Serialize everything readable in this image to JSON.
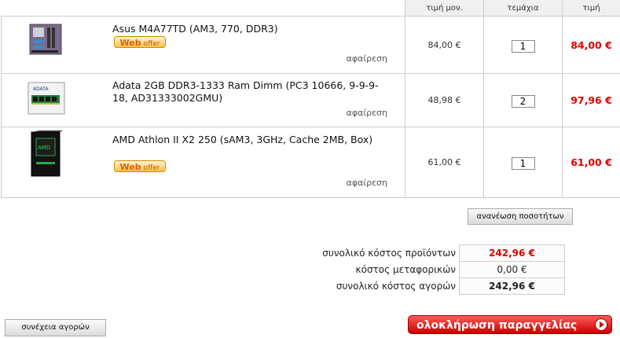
{
  "header": {
    "unit_price": "τιμή μον.",
    "quantity": "τεμάχια",
    "price": "τιμή"
  },
  "items": [
    {
      "name": "Asus M4A77TD (AM3, 770, DDR3)",
      "web_offer": true,
      "web_offer_label": {
        "web": "Web",
        "offer": "offer"
      },
      "remove_label": "αφαίρεση",
      "unit_price": "84,00 €",
      "quantity": "1",
      "price": "84,00 €",
      "icon": "motherboard-icon"
    },
    {
      "name": "Adata 2GB DDR3-1333 Ram Dimm (PC3 10666, 9-9-9-18, AD31333002GMU)",
      "web_offer": false,
      "remove_label": "αφαίρεση",
      "unit_price": "48,98 €",
      "quantity": "2",
      "price": "97,96 €",
      "icon": "ram-module-icon"
    },
    {
      "name": "AMD Athlon II X2 250 (sAM3, 3GHz, Cache 2MB, Box)",
      "web_offer": true,
      "web_offer_label": {
        "web": "Web",
        "offer": "offer"
      },
      "remove_label": "αφαίρεση",
      "unit_price": "61,00 €",
      "quantity": "1",
      "price": "61,00 €",
      "icon": "cpu-box-icon"
    }
  ],
  "update_button": "ανανέωση ποσοτήτων",
  "summary": {
    "products_label": "συνολικό κόστος προϊόντων",
    "products_value": "242,96 €",
    "shipping_label": "κόστος μεταφορικών",
    "shipping_value": "0,00 €",
    "total_label": "συνολικό κόστος αγορών",
    "total_value": "242,96 €"
  },
  "continue_button": "συνέχεια αγορών",
  "checkout_button": "ολοκλήρωση παραγγελίας",
  "colors": {
    "price_red": "#e00000",
    "checkout_red": "#cc0000"
  }
}
